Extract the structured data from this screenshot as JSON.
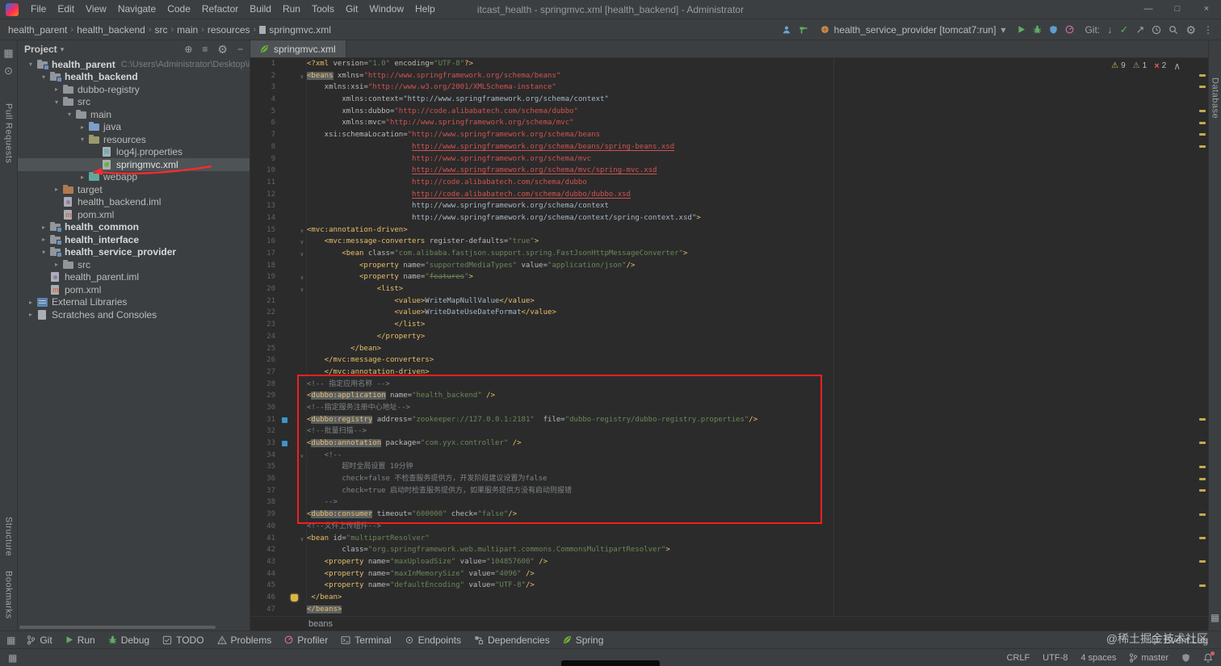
{
  "window": {
    "title": "itcast_health - springmvc.xml [health_backend] - Administrator",
    "menu": [
      "File",
      "Edit",
      "View",
      "Navigate",
      "Code",
      "Refactor",
      "Build",
      "Run",
      "Tools",
      "Git",
      "Window",
      "Help"
    ],
    "control_icons": [
      "minimize-icon",
      "maximize-icon",
      "close-icon"
    ]
  },
  "navbar": {
    "breadcrumbs": [
      "health_parent",
      "health_backend",
      "src",
      "main",
      "resources",
      "springmvc.xml"
    ],
    "left_icons": [
      "code-with-me-icon",
      "build-hammer-icon"
    ],
    "run_config": "health_service_provider [tomcat7:run]",
    "run_icons": [
      "run-icon",
      "debug-icon",
      "coverage-icon",
      "profiler-icon"
    ],
    "git_label": "Git:",
    "git_icons": [
      "update-icon",
      "commit-check-icon",
      "push-icon"
    ],
    "far_icons": [
      "history-icon",
      "search-icon",
      "settings-icon",
      "more-icon"
    ]
  },
  "left_stripe": {
    "top_icons": [
      "project-icon",
      "commit-icon"
    ],
    "upper_label": "Pull Requests",
    "lower_labels": [
      "Structure",
      "Bookmarks"
    ]
  },
  "right_stripe": {
    "label": "Database",
    "bottom_icons": [
      "layout-icon"
    ]
  },
  "project_panel": {
    "title": "Project",
    "header_icons": [
      "locate-icon",
      "collapse-all-icon",
      "settings-icon",
      "hide-icon"
    ],
    "tree": [
      {
        "label": "health_parent",
        "sub": "C:\\Users\\Administrator\\Desktop\\itcast_he",
        "level": 0,
        "icon": "folder-module",
        "chevron": "expanded",
        "bold": true
      },
      {
        "label": "health_backend",
        "level": 1,
        "icon": "folder-module",
        "chevron": "expanded",
        "bold": true
      },
      {
        "label": "dubbo-registry",
        "level": 2,
        "icon": "folder",
        "chevron": "collapsed"
      },
      {
        "label": "src",
        "level": 2,
        "icon": "folder",
        "chevron": "expanded"
      },
      {
        "label": "main",
        "level": 3,
        "icon": "folder",
        "chevron": "expanded"
      },
      {
        "label": "java",
        "level": 4,
        "icon": "folder-source",
        "chevron": "collapsed"
      },
      {
        "label": "resources",
        "level": 4,
        "icon": "folder-resources",
        "chevron": "expanded"
      },
      {
        "label": "log4j.properties",
        "level": 5,
        "icon": "file-properties"
      },
      {
        "label": "springmvc.xml",
        "level": 5,
        "icon": "file-spring",
        "selected": true,
        "annotation": "red-arrow"
      },
      {
        "label": "webapp",
        "level": 4,
        "icon": "folder-web",
        "chevron": "collapsed"
      },
      {
        "label": "target",
        "level": 2,
        "icon": "folder-excluded",
        "chevron": "collapsed"
      },
      {
        "label": "health_backend.iml",
        "level": 2,
        "icon": "file-iml"
      },
      {
        "label": "pom.xml",
        "level": 2,
        "icon": "file-maven"
      },
      {
        "label": "health_common",
        "level": 1,
        "icon": "folder-module",
        "chevron": "collapsed",
        "bold": true
      },
      {
        "label": "health_interface",
        "level": 1,
        "icon": "folder-module",
        "chevron": "collapsed",
        "bold": true
      },
      {
        "label": "health_service_provider",
        "level": 1,
        "icon": "folder-module",
        "chevron": "expanded",
        "bold": true
      },
      {
        "label": "src",
        "level": 2,
        "icon": "folder",
        "chevron": "collapsed"
      },
      {
        "label": "health_parent.iml",
        "level": 1,
        "icon": "file-iml"
      },
      {
        "label": "pom.xml",
        "level": 1,
        "icon": "file-maven"
      },
      {
        "label": "External Libraries",
        "level": 0,
        "icon": "libraries",
        "chevron": "collapsed"
      },
      {
        "label": "Scratches and Consoles",
        "level": 0,
        "icon": "scratches",
        "chevron": "collapsed"
      }
    ]
  },
  "editor": {
    "tab": {
      "label": "springmvc.xml",
      "icon": "spring-icon"
    },
    "inspections": {
      "warnings": "9",
      "weak_warnings": "1",
      "errors": "2"
    },
    "breadcrumb": "beans",
    "stripe_marks": [
      2,
      3,
      5,
      6,
      7,
      8,
      31,
      33,
      35,
      36,
      37,
      39,
      41,
      43,
      45
    ],
    "gutter": {
      "fold_lines": [
        2,
        15,
        16,
        17,
        19,
        20,
        34,
        41
      ],
      "change_lines": [
        31,
        33
      ],
      "bulb_line": 46
    },
    "highlight_box": {
      "from_line": 28,
      "to_line": 39
    },
    "lines": [
      {
        "n": 1,
        "i": 0,
        "s": [
          [
            "t",
            "<?xml "
          ],
          [
            "a",
            "version="
          ],
          [
            "s",
            "\"1.0\""
          ],
          [
            "a",
            " encoding="
          ],
          [
            "s",
            "\"UTF-8\""
          ],
          [
            "t",
            "?>"
          ]
        ]
      },
      {
        "n": 2,
        "i": 0,
        "s": [
          [
            "h",
            "<beans"
          ],
          [
            "a",
            " xmlns="
          ],
          [
            "r",
            "\"http://www.springframework.org/schema/beans\""
          ]
        ]
      },
      {
        "n": 3,
        "i": 4,
        "s": [
          [
            "a",
            "xmlns:xsi="
          ],
          [
            "r",
            "\"http://www.w3.org/2001/XMLSchema-instance\""
          ]
        ]
      },
      {
        "n": 4,
        "i": 8,
        "s": [
          [
            "a",
            "xmlns:context="
          ],
          [
            "g",
            "\"http://www.springframework.org/schema/context\""
          ]
        ]
      },
      {
        "n": 5,
        "i": 8,
        "s": [
          [
            "a",
            "xmlns:dubbo="
          ],
          [
            "r",
            "\"http://code.alibabatech.com/schema/dubbo\""
          ]
        ]
      },
      {
        "n": 6,
        "i": 8,
        "s": [
          [
            "a",
            "xmlns:mvc="
          ],
          [
            "r",
            "\"http://www.springframework.org/schema/mvc\""
          ]
        ]
      },
      {
        "n": 7,
        "i": 4,
        "s": [
          [
            "a",
            "xsi:schemaLocation="
          ],
          [
            "r",
            "\"http://www.springframework.org/schema/beans"
          ]
        ]
      },
      {
        "n": 8,
        "i": 24,
        "s": [
          [
            "u",
            "http://www.springframework.org/schema/beans/spring-beans.xsd"
          ]
        ]
      },
      {
        "n": 9,
        "i": 24,
        "s": [
          [
            "r",
            "http://www.springframework.org/schema/mvc"
          ]
        ]
      },
      {
        "n": 10,
        "i": 24,
        "s": [
          [
            "u",
            "http://www.springframework.org/schema/mvc/spring-mvc.xsd"
          ]
        ]
      },
      {
        "n": 11,
        "i": 24,
        "s": [
          [
            "r",
            "http://code.alibabatech.com/schema/dubbo"
          ]
        ]
      },
      {
        "n": 12,
        "i": 24,
        "s": [
          [
            "u",
            "http://code.alibabatech.com/schema/dubbo/dubbo.xsd"
          ]
        ]
      },
      {
        "n": 13,
        "i": 24,
        "s": [
          [
            "g",
            "http://www.springframework.org/schema/context"
          ]
        ]
      },
      {
        "n": 14,
        "i": 24,
        "s": [
          [
            "g",
            "http://www.springframework.org/schema/context/spring-context.xsd\""
          ],
          [
            "t",
            ">"
          ]
        ]
      },
      {
        "n": 15,
        "i": 0,
        "s": [
          [
            "t",
            "<mvc:annotation-driven>"
          ]
        ]
      },
      {
        "n": 16,
        "i": 4,
        "s": [
          [
            "t",
            "<mvc:message-converters "
          ],
          [
            "a",
            "register-defaults="
          ],
          [
            "s",
            "\"true\""
          ],
          [
            "t",
            ">"
          ]
        ]
      },
      {
        "n": 17,
        "i": 8,
        "s": [
          [
            "t",
            "<bean "
          ],
          [
            "a",
            "class="
          ],
          [
            "s",
            "\"com.alibaba.fastjson.support.spring.FastJsonHttpMessageConverter\""
          ],
          [
            "t",
            ">"
          ]
        ]
      },
      {
        "n": 18,
        "i": 12,
        "s": [
          [
            "t",
            "<property "
          ],
          [
            "a",
            "name="
          ],
          [
            "s",
            "\"supportedMediaTypes\""
          ],
          [
            "a",
            " value="
          ],
          [
            "s",
            "\"application/json\""
          ],
          [
            "t",
            "/>"
          ]
        ]
      },
      {
        "n": 19,
        "i": 12,
        "s": [
          [
            "t",
            "<property "
          ],
          [
            "a",
            "name="
          ],
          [
            "s",
            "\""
          ],
          [
            "k",
            "features"
          ],
          [
            "s",
            "\""
          ],
          [
            "t",
            ">"
          ]
        ]
      },
      {
        "n": 20,
        "i": 16,
        "s": [
          [
            "t",
            "<list>"
          ]
        ]
      },
      {
        "n": 21,
        "i": 20,
        "s": [
          [
            "t",
            "<value>"
          ],
          [
            "w",
            "WriteMapNullValue"
          ],
          [
            "t",
            "</value>"
          ]
        ]
      },
      {
        "n": 22,
        "i": 20,
        "s": [
          [
            "t",
            "<value>"
          ],
          [
            "w",
            "WriteDateUseDateFormat"
          ],
          [
            "t",
            "</value>"
          ]
        ]
      },
      {
        "n": 23,
        "i": 20,
        "s": [
          [
            "t",
            "</list>"
          ]
        ]
      },
      {
        "n": 24,
        "i": 16,
        "s": [
          [
            "t",
            "</property>"
          ]
        ]
      },
      {
        "n": 25,
        "i": 10,
        "s": [
          [
            "t",
            "</bean>"
          ]
        ]
      },
      {
        "n": 26,
        "i": 4,
        "s": [
          [
            "t",
            "</mvc:message-converters>"
          ]
        ]
      },
      {
        "n": 27,
        "i": 4,
        "s": [
          [
            "t",
            "</mvc:annotation-driven>"
          ]
        ]
      },
      {
        "n": 28,
        "i": 0,
        "s": [
          [
            "c",
            "<!-- 指定应用名称 -->"
          ]
        ]
      },
      {
        "n": 29,
        "i": 0,
        "s": [
          [
            "t",
            "<"
          ],
          [
            "h",
            "dubbo:application"
          ],
          [
            "a",
            " name="
          ],
          [
            "s",
            "\"health_backend\""
          ],
          [
            "t",
            " />"
          ]
        ]
      },
      {
        "n": 30,
        "i": 0,
        "s": [
          [
            "c",
            "<!--指定服务注册中心地址-->"
          ]
        ]
      },
      {
        "n": 31,
        "i": 0,
        "s": [
          [
            "t",
            "<"
          ],
          [
            "h",
            "dubbo:registry"
          ],
          [
            "a",
            " address="
          ],
          [
            "s",
            "\"zookeeper://127.0.0.1:2181\""
          ],
          [
            "a",
            "  file="
          ],
          [
            "s",
            "\"dubbo-registry/dubbo-registry.properties\""
          ],
          [
            "t",
            "/>"
          ]
        ]
      },
      {
        "n": 32,
        "i": 0,
        "s": [
          [
            "c",
            "<!--批量扫描-->"
          ]
        ]
      },
      {
        "n": 33,
        "i": 0,
        "s": [
          [
            "t",
            "<"
          ],
          [
            "h",
            "dubbo:annotation"
          ],
          [
            "a",
            " package="
          ],
          [
            "s",
            "\"com.yyx.controller\""
          ],
          [
            "t",
            " />"
          ]
        ]
      },
      {
        "n": 34,
        "i": 4,
        "s": [
          [
            "c",
            "<!--"
          ]
        ]
      },
      {
        "n": 35,
        "i": 8,
        "s": [
          [
            "c",
            "超时全局设置 10分钟"
          ]
        ]
      },
      {
        "n": 36,
        "i": 8,
        "s": [
          [
            "c",
            "check=false 不检查服务提供方，开发阶段建议设置为false"
          ]
        ]
      },
      {
        "n": 37,
        "i": 8,
        "s": [
          [
            "c",
            "check=true 启动时检查服务提供方，如果服务提供方没有启动则报错"
          ]
        ]
      },
      {
        "n": 38,
        "i": 4,
        "s": [
          [
            "c",
            "-->"
          ]
        ]
      },
      {
        "n": 39,
        "i": 0,
        "s": [
          [
            "t",
            "<"
          ],
          [
            "h",
            "dubbo:consumer"
          ],
          [
            "a",
            " timeout="
          ],
          [
            "s",
            "\"600000\""
          ],
          [
            "a",
            " check="
          ],
          [
            "s",
            "\"false\""
          ],
          [
            "t",
            "/>"
          ]
        ]
      },
      {
        "n": 40,
        "i": 0,
        "s": [
          [
            "c",
            "<!--文件上传组件-->"
          ]
        ]
      },
      {
        "n": 41,
        "i": 0,
        "s": [
          [
            "t",
            "<bean "
          ],
          [
            "a",
            "id="
          ],
          [
            "s",
            "\"multipartResolver\""
          ]
        ]
      },
      {
        "n": 42,
        "i": 8,
        "s": [
          [
            "a",
            "class="
          ],
          [
            "s",
            "\"org.springframework.web.multipart.commons.CommonsMultipartResolver\""
          ],
          [
            "t",
            ">"
          ]
        ]
      },
      {
        "n": 43,
        "i": 4,
        "s": [
          [
            "t",
            "<property "
          ],
          [
            "a",
            "name="
          ],
          [
            "s",
            "\"maxUploadSize\""
          ],
          [
            "a",
            " value="
          ],
          [
            "s",
            "\"104857600\""
          ],
          [
            "t",
            " />"
          ]
        ]
      },
      {
        "n": 44,
        "i": 4,
        "s": [
          [
            "t",
            "<property "
          ],
          [
            "a",
            "name="
          ],
          [
            "s",
            "\"maxInMemorySize\""
          ],
          [
            "a",
            " value="
          ],
          [
            "s",
            "\"4096\""
          ],
          [
            "t",
            " />"
          ]
        ]
      },
      {
        "n": 45,
        "i": 4,
        "s": [
          [
            "t",
            "<property "
          ],
          [
            "a",
            "name="
          ],
          [
            "s",
            "\"defaultEncoding\""
          ],
          [
            "a",
            " value="
          ],
          [
            "s",
            "\"UTF-8\""
          ],
          [
            "t",
            "/>"
          ]
        ]
      },
      {
        "n": 46,
        "i": 1,
        "s": [
          [
            "t",
            "</bean>"
          ]
        ]
      },
      {
        "n": 47,
        "i": 0,
        "s": [
          [
            "h",
            "</beans>"
          ]
        ]
      }
    ]
  },
  "bottom_bar": {
    "items": [
      {
        "label": "Git",
        "icon": "branch-icon"
      },
      {
        "label": "Run",
        "icon": "run-icon"
      },
      {
        "label": "Debug",
        "icon": "debug-icon"
      },
      {
        "label": "TODO",
        "icon": "todo-icon"
      },
      {
        "label": "Problems",
        "icon": "problems-icon"
      },
      {
        "label": "Profiler",
        "icon": "profiler-icon"
      },
      {
        "label": "Terminal",
        "icon": "terminal-icon"
      },
      {
        "label": "Endpoints",
        "icon": "endpoints-icon"
      },
      {
        "label": "Dependencies",
        "icon": "dependencies-icon"
      },
      {
        "label": "Spring",
        "icon": "spring-icon"
      }
    ],
    "event_log": "Event Log",
    "watermark": "@稀土掘金技术社区"
  },
  "status_bar": {
    "left_icons": [
      "toolwindows-icon"
    ],
    "items": [
      "CRLF",
      "UTF-8",
      "4 spaces"
    ],
    "branch": "master",
    "right_icons": [
      "hector-icon",
      "bell-icon"
    ]
  }
}
